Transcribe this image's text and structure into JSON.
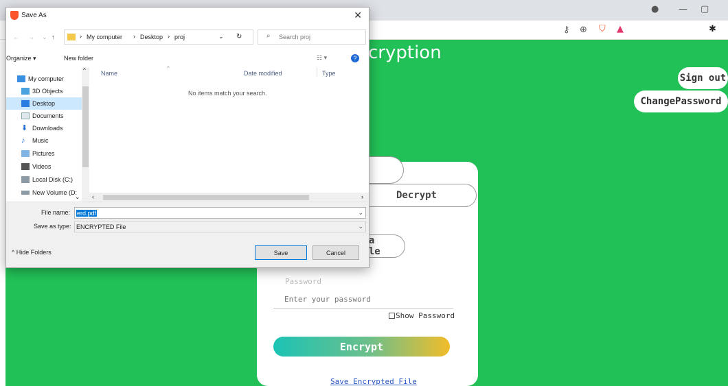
{
  "browser": {
    "minimize_glyph": "—",
    "restore_glyph": "▢",
    "key_icon": "key-icon",
    "zoom_icon": "zoom-icon",
    "brave_color": "#fb542b"
  },
  "page": {
    "title_partial": "cryption",
    "sign_out": "Sign out",
    "change_password": "ChangePassword",
    "decrypt_tab": "Decrypt",
    "upload_partial": "l a file",
    "password_label": "Password",
    "password_placeholder": "Enter your password",
    "show_password": "Show Password",
    "encrypt_button": "Encrypt",
    "save_link": "Save Encrypted File",
    "accent": "#22c157"
  },
  "dialog": {
    "title": "Save As",
    "close": "✕",
    "breadcrumb": [
      "My computer",
      "Desktop",
      "proj"
    ],
    "search_placeholder": "Search proj",
    "organize": "Organize ▾",
    "new_folder": "New folder",
    "nav_items": [
      {
        "label": "My computer",
        "icon": "computer-icon"
      },
      {
        "label": "3D Objects",
        "icon": "cube-icon"
      },
      {
        "label": "Desktop",
        "icon": "desktop-icon"
      },
      {
        "label": "Documents",
        "icon": "document-icon"
      },
      {
        "label": "Downloads",
        "icon": "download-icon"
      },
      {
        "label": "Music",
        "icon": "music-icon"
      },
      {
        "label": "Pictures",
        "icon": "picture-icon"
      },
      {
        "label": "Videos",
        "icon": "video-icon"
      },
      {
        "label": "Local Disk (C:)",
        "icon": "drive-icon"
      },
      {
        "label": "New Volume (D:",
        "icon": "drive-icon"
      }
    ],
    "columns": [
      "Name",
      "Date modified",
      "Type"
    ],
    "empty_message": "No items match your search.",
    "file_name_label": "File name:",
    "file_name_value": "erd.pdf",
    "save_type_label": "Save as type:",
    "save_type_value": "ENCRYPTED File",
    "hide_folders": "Hide Folders",
    "save_button": "Save",
    "cancel_button": "Cancel"
  }
}
